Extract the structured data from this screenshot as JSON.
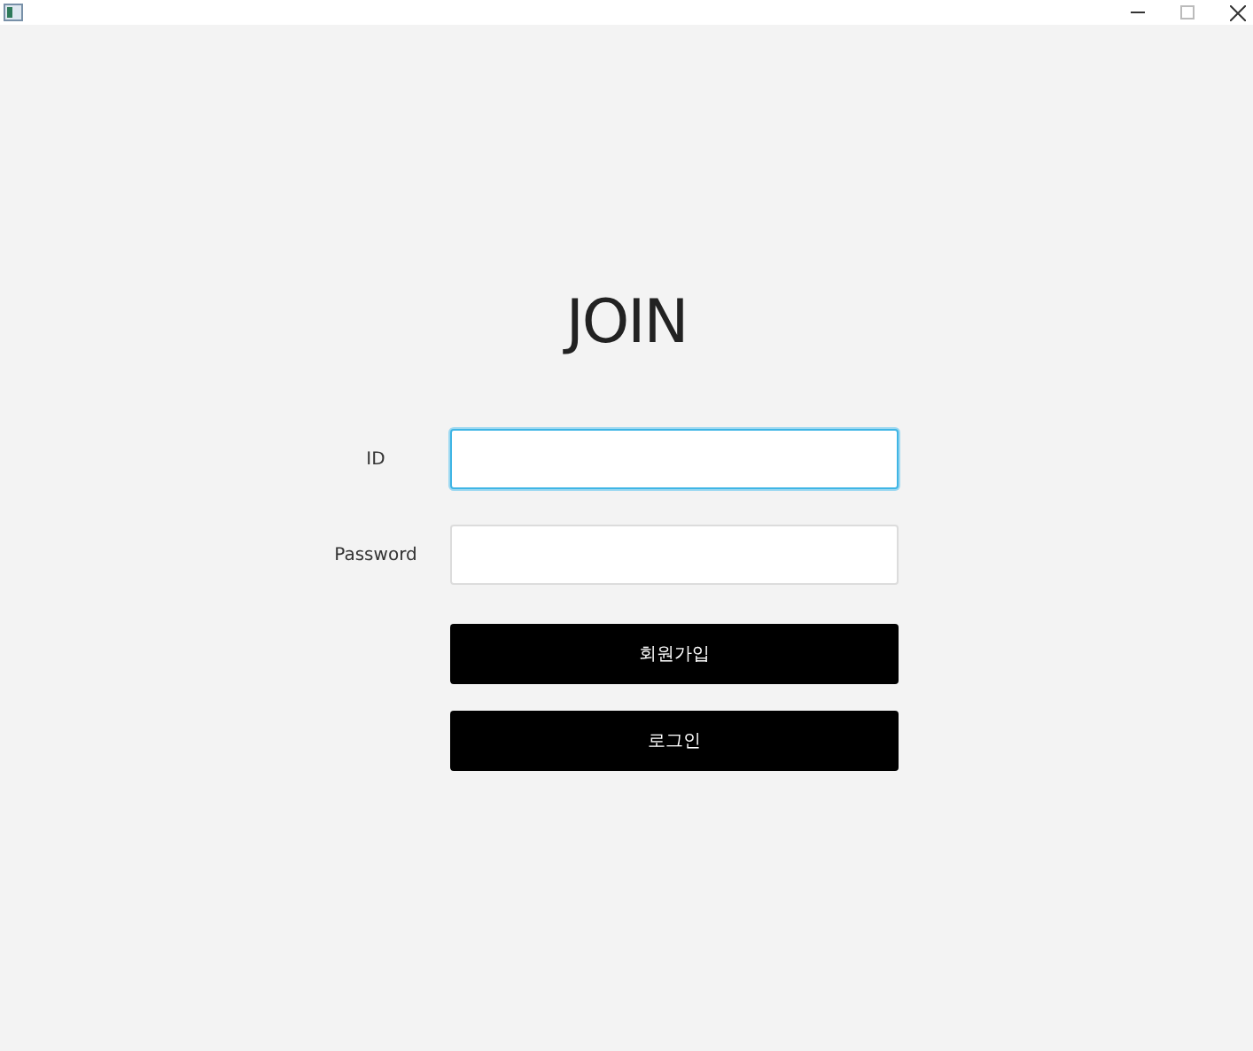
{
  "title": "JOIN",
  "fields": [
    {
      "label": "ID",
      "focused": true
    },
    {
      "label": "Password",
      "focused": false
    }
  ],
  "buttons": [
    "회원가입",
    "로그인"
  ]
}
